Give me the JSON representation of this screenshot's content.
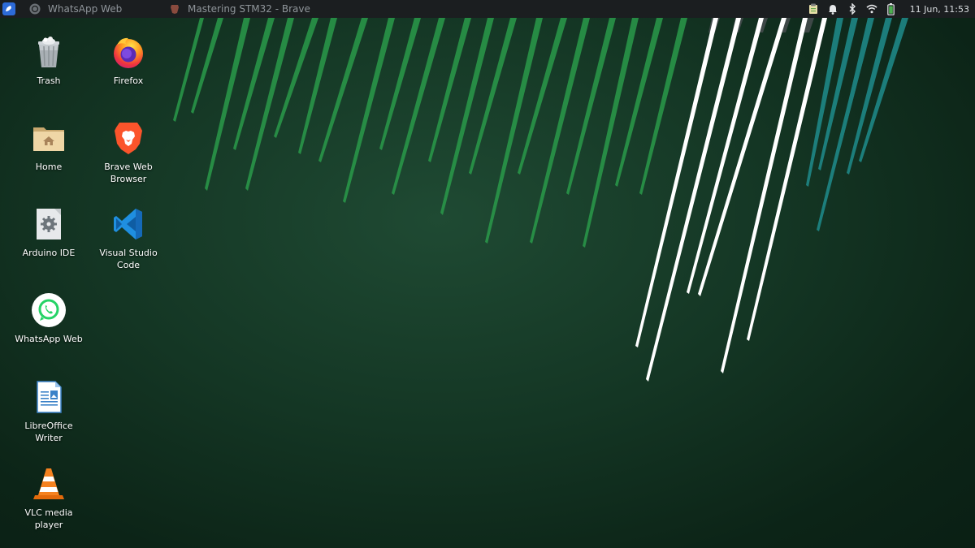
{
  "panel": {
    "tasks": [
      {
        "label": "WhatsApp Web",
        "icon": "whatsapp-icon"
      },
      {
        "label": "Mastering STM32 - Brave",
        "icon": "brave-icon"
      }
    ],
    "tray_icons": [
      "clipboard-icon",
      "bell-icon",
      "bluetooth-icon",
      "wifi-icon",
      "battery-icon"
    ],
    "clock": "11 Jun, 11:53"
  },
  "desktop": {
    "icons": [
      {
        "label": "Trash",
        "icon": "trash-icon"
      },
      {
        "label": "Firefox",
        "icon": "firefox-icon"
      },
      {
        "label": "Home",
        "icon": "home-folder-icon"
      },
      {
        "label": "Brave Web Browser",
        "icon": "brave-icon"
      },
      {
        "label": "Arduino IDE",
        "icon": "arduino-ide-icon"
      },
      {
        "label": "Visual Studio Code",
        "icon": "vscode-icon"
      },
      {
        "label": "WhatsApp Web",
        "icon": "whatsapp-icon"
      },
      {
        "label": "LibreOffice Writer",
        "icon": "libreoffice-writer-icon"
      },
      {
        "label": "VLC media player",
        "icon": "vlc-icon"
      }
    ]
  },
  "colors": {
    "panel_bg": "#1b1e20",
    "wallpaper_green": "#143624",
    "stripe_green": "#2ea04f",
    "stripe_teal": "#1b8a8a",
    "stripe_white": "#ffffff"
  }
}
